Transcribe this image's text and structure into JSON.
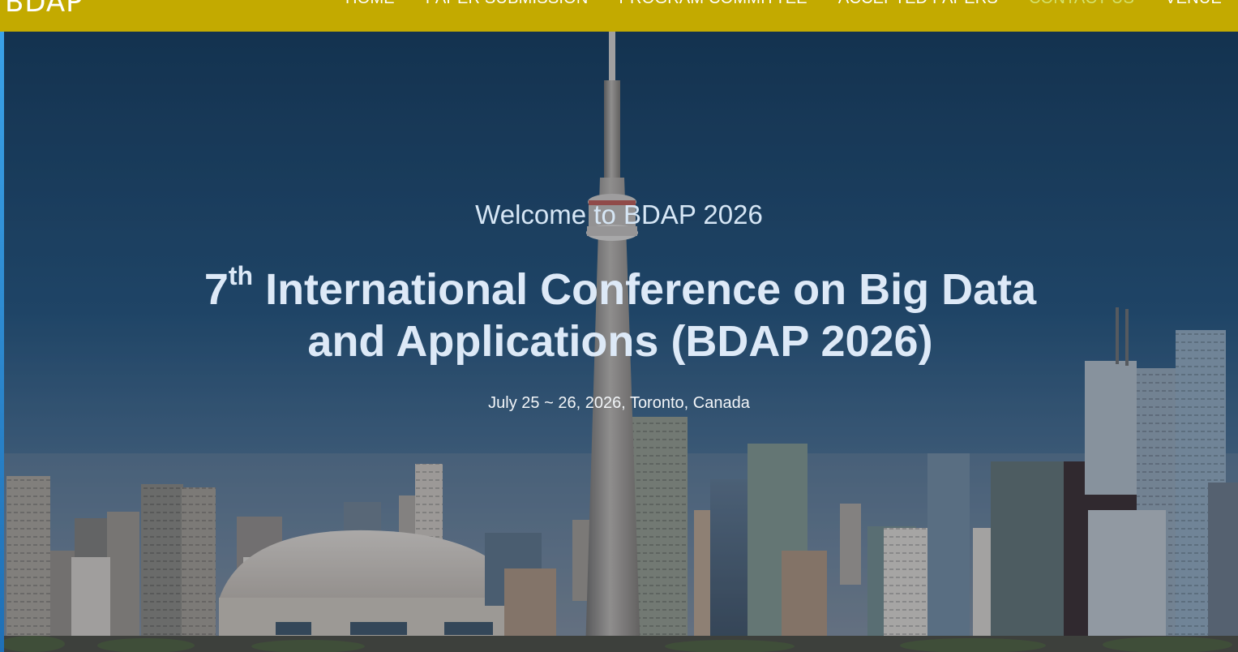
{
  "header": {
    "brand": "BDAP",
    "nav": [
      "HOME",
      "PAPER SUBMISSION",
      "PROGRAM COMMITTEE",
      "ACCEPTED PAPERS",
      "CONTACT US",
      "VENUE"
    ],
    "active_item": "CONTACT US"
  },
  "hero": {
    "welcome": "Welcome to BDAP 2026",
    "title_ordinal": "7",
    "title_ordinal_suffix": "th",
    "title_text": " International Conference on Big Data and Applications (BDAP 2026)",
    "dateline": "July 25 ~ 26, 2026, Toronto, Canada",
    "background_image": "toronto-skyline-with-cn-tower"
  },
  "colors": {
    "header_bg": "#c3aa00",
    "nav_active": "#d4e26b",
    "nav_text": "#ffffff",
    "sky_top": "#163857",
    "sky_bottom": "#6a7b8e",
    "hero_text": "#dde9f7"
  }
}
